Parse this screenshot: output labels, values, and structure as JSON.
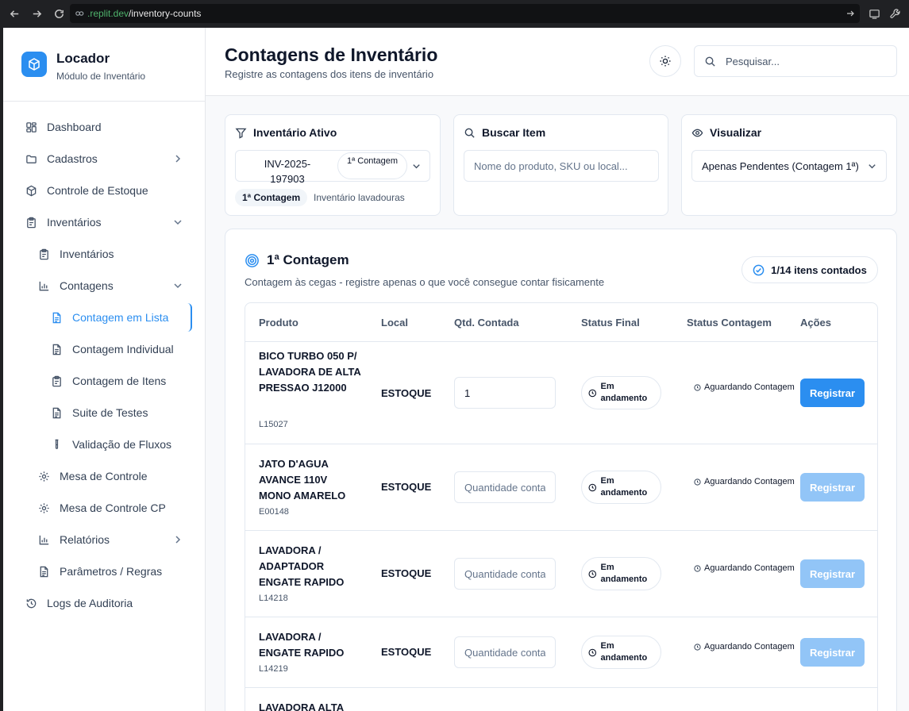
{
  "browser": {
    "url_host": ".replit.dev",
    "url_path": "/inventory-counts"
  },
  "sidebar": {
    "brand_title": "Locador",
    "brand_subtitle": "Módulo de Inventário",
    "items": [
      {
        "label": "Dashboard",
        "icon": "dashboard-icon"
      },
      {
        "label": "Cadastros",
        "icon": "folder-icon",
        "has_children": true
      },
      {
        "label": "Controle de Estoque",
        "icon": "box-icon"
      },
      {
        "label": "Inventários",
        "icon": "clipboard-icon",
        "expanded": true
      },
      {
        "label": "Inventários",
        "icon": "clipboard-icon"
      },
      {
        "label": "Contagens",
        "icon": "bar-chart-icon",
        "expanded": true
      },
      {
        "label": "Contagem em Lista",
        "icon": "file-text-icon",
        "active": true
      },
      {
        "label": "Contagem Individual",
        "icon": "file-text-icon"
      },
      {
        "label": "Contagem de Itens",
        "icon": "clipboard-icon"
      },
      {
        "label": "Suite de Testes",
        "icon": "file-text-icon"
      },
      {
        "label": "Validação de Fluxos",
        "icon": "test-tube-icon"
      },
      {
        "label": "Mesa de Controle",
        "icon": "gear-icon"
      },
      {
        "label": "Mesa de Controle CP",
        "icon": "gear-icon"
      },
      {
        "label": "Relatórios",
        "icon": "bar-chart-icon",
        "has_children": true
      },
      {
        "label": "Parâmetros / Regras",
        "icon": "file-text-icon"
      },
      {
        "label": "Logs de Auditoria",
        "icon": "history-icon"
      }
    ]
  },
  "header": {
    "title": "Contagens de Inventário",
    "subtitle": "Registre as contagens dos itens de inventário",
    "search_placeholder": "Pesquisar..."
  },
  "filters": {
    "active_inventory": {
      "title": "Inventário Ativo",
      "code": "INV-2025-197903",
      "count_pill": "1ª Contagem",
      "badge": "1ª Contagem",
      "description": "Inventário lavadouras"
    },
    "search_item": {
      "title": "Buscar Item",
      "placeholder": "Nome do produto, SKU ou local..."
    },
    "view": {
      "title": "Visualizar",
      "selected": "Apenas Pendentes (Contagem 1ª)"
    }
  },
  "counting": {
    "title": "1ª Contagem",
    "subtitle": "Contagem às cegas - registre apenas o que você consegue contar fisicamente",
    "progress": "1/14 itens contados",
    "columns": [
      "Produto",
      "Local",
      "Qtd. Contada",
      "Status Final",
      "Status Contagem",
      "Ações"
    ],
    "qty_placeholder": "Quantidade contada",
    "rows": [
      {
        "name": "BICO TURBO 050 P/ LAVADORA DE ALTA PRESSAO J12000",
        "code": "L15027",
        "local": "ESTOQUE",
        "qty": "1",
        "status_final": "Em andamento",
        "status_count": "Aguardando Contagem",
        "action": "Registrar",
        "enabled": true
      },
      {
        "name": "JATO D'AGUA AVANCE 110V MONO AMARELO",
        "code": "E00148",
        "local": "ESTOQUE",
        "qty": "",
        "status_final": "Em andamento",
        "status_count": "Aguardando Contagem",
        "action": "Registrar",
        "enabled": false
      },
      {
        "name": "LAVADORA / ADAPTADOR ENGATE RAPIDO",
        "code": "L14218",
        "local": "ESTOQUE",
        "qty": "",
        "status_final": "Em andamento",
        "status_count": "Aguardando Contagem",
        "action": "Registrar",
        "enabled": false
      },
      {
        "name": "LAVADORA / ENGATE RAPIDO",
        "code": "L14219",
        "local": "ESTOQUE",
        "qty": "",
        "status_final": "Em andamento",
        "status_count": "Aguardando Contagem",
        "action": "Registrar",
        "enabled": false
      },
      {
        "name": "LAVADORA ALTA",
        "code": "",
        "local": "",
        "qty": "",
        "status_final": "",
        "status_count": "",
        "action": "",
        "enabled": false
      }
    ]
  },
  "colors": {
    "accent": "#2b8ef0",
    "accent_disabled": "#92c5f7",
    "browser_bg": "#202124"
  }
}
